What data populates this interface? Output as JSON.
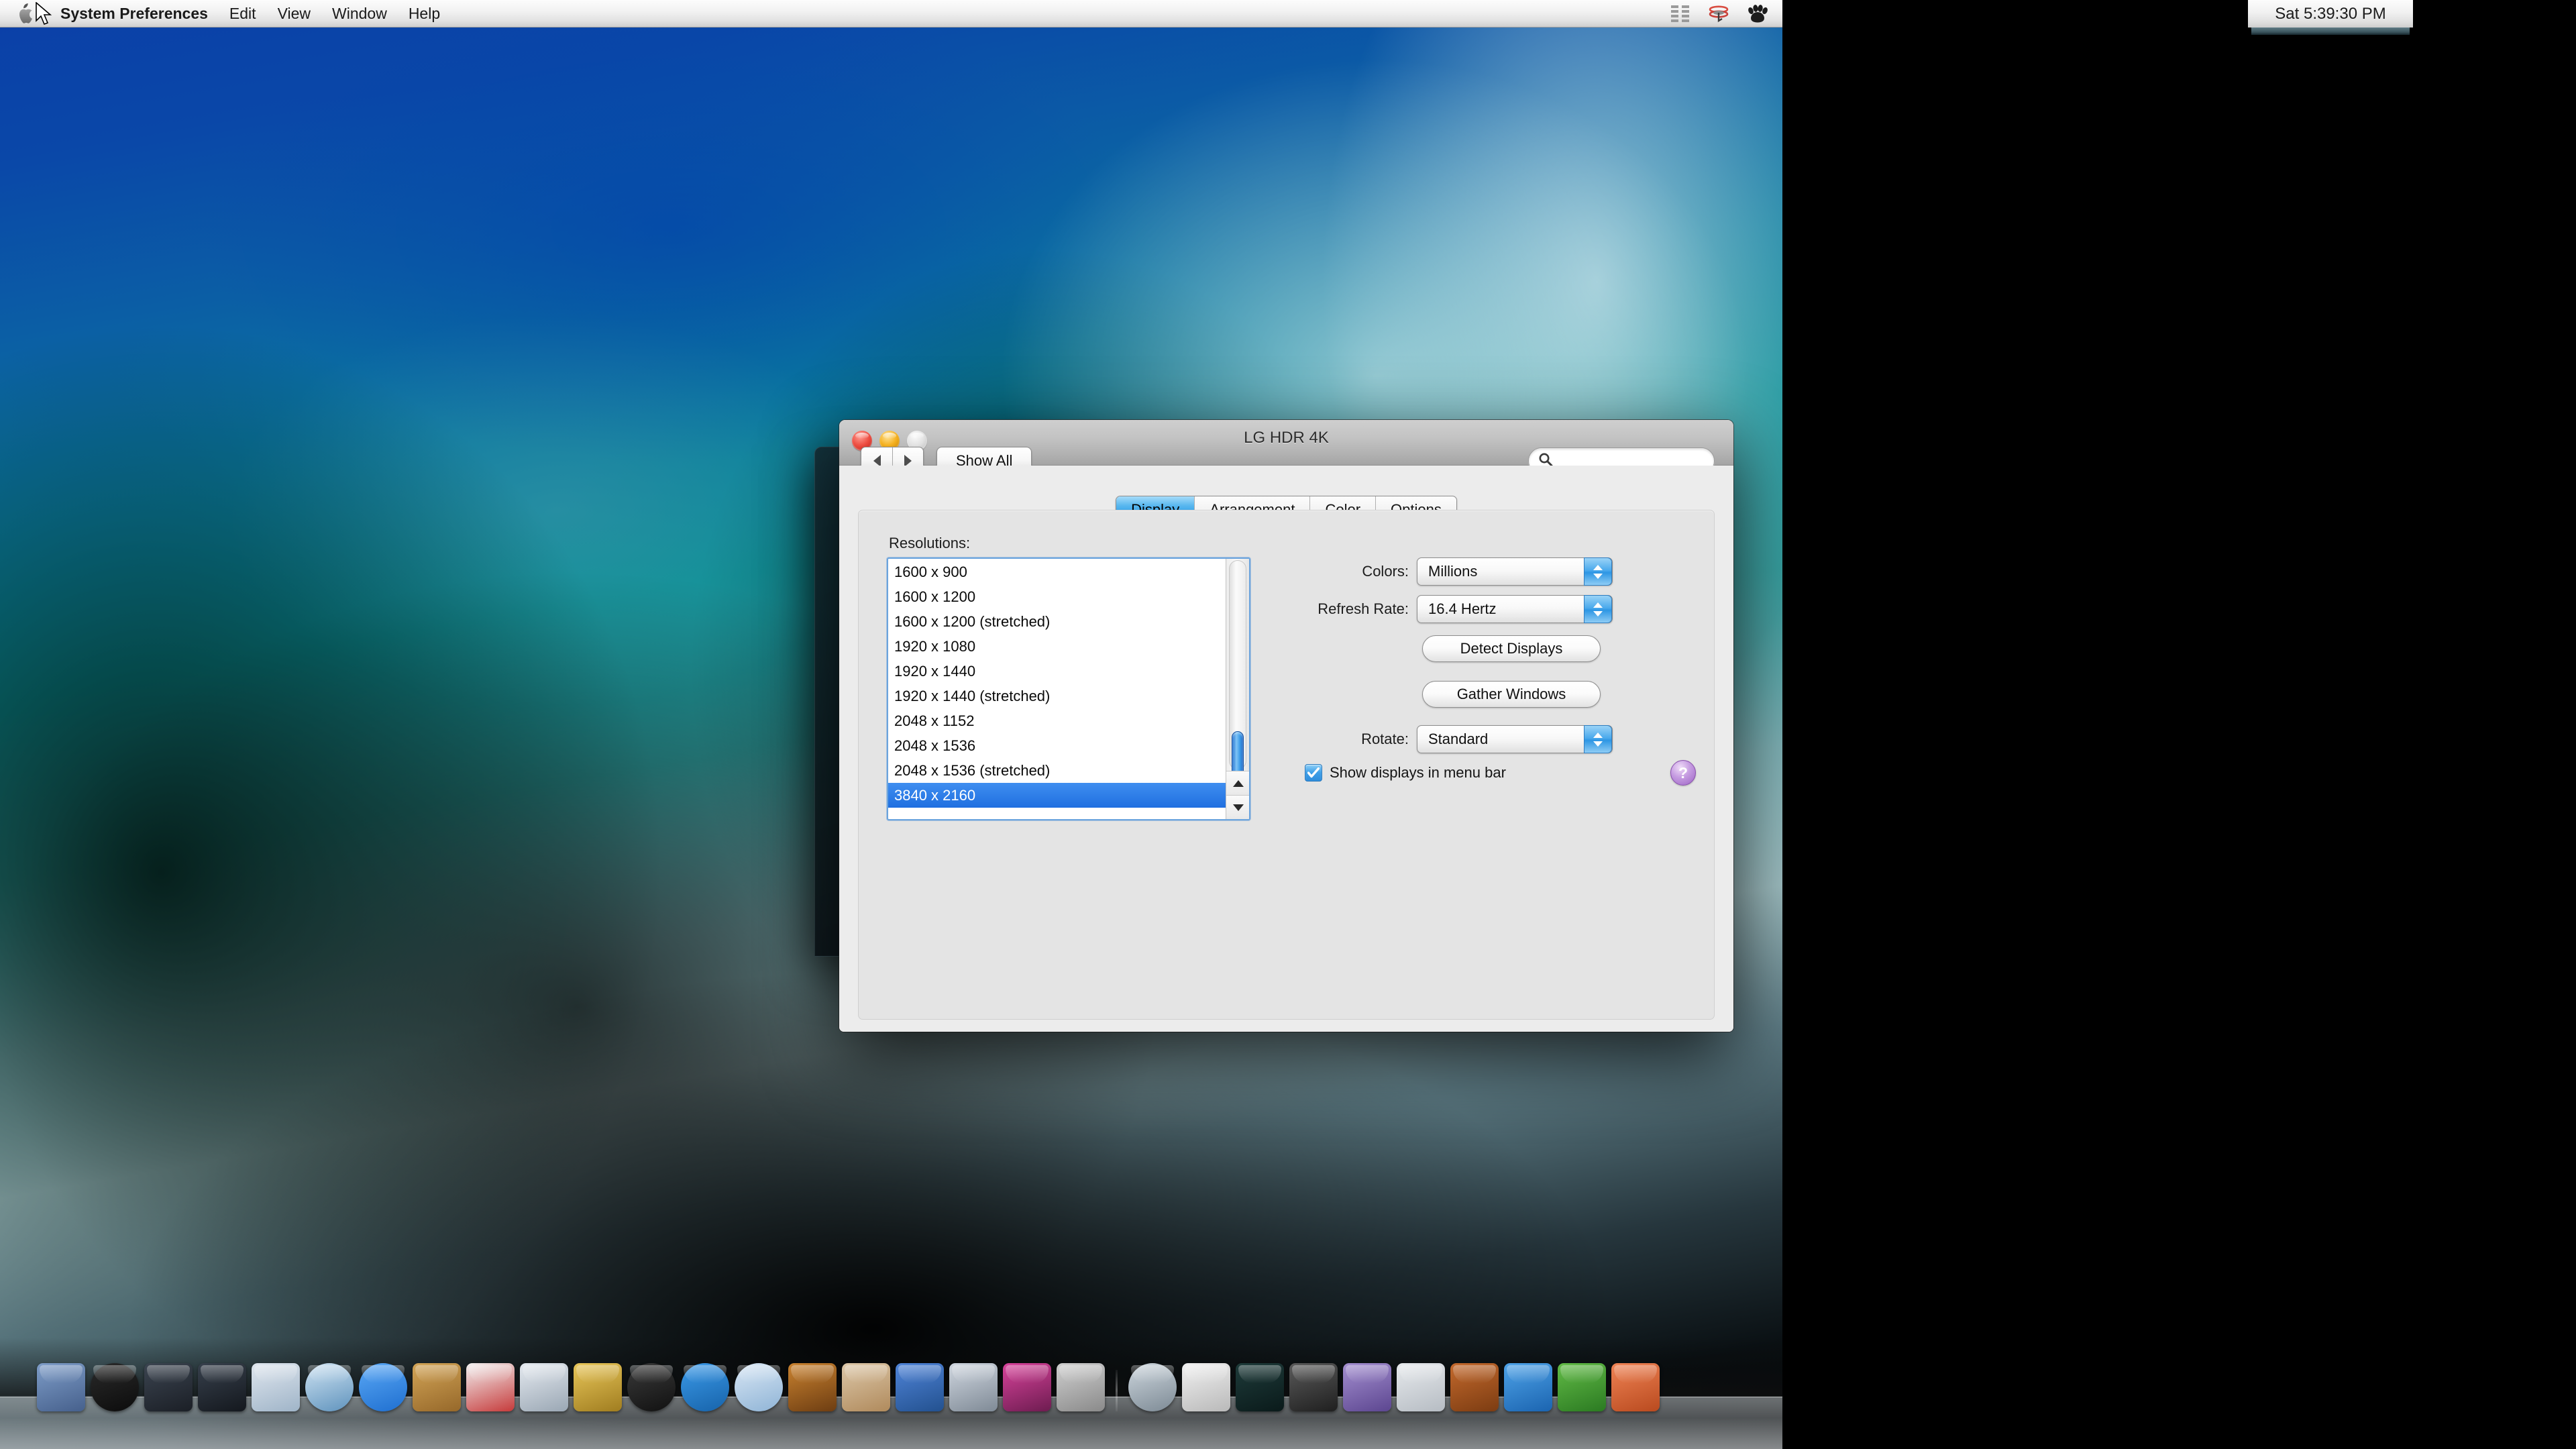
{
  "menubar": {
    "apple_icon": "apple-logo-icon",
    "items": [
      {
        "label": "System Preferences",
        "bold": true
      },
      {
        "label": "Edit",
        "bold": false
      },
      {
        "label": "View",
        "bold": false
      },
      {
        "label": "Window",
        "bold": false
      },
      {
        "label": "Help",
        "bold": false
      }
    ],
    "extras": [
      {
        "name": "text-input-menu-icon"
      },
      {
        "name": "displays-menu-icon"
      },
      {
        "name": "paw-print-menu-icon"
      }
    ]
  },
  "clock": {
    "text": "Sat 5:39:30 PM"
  },
  "window": {
    "title": "LG HDR 4K",
    "traffic_lights": [
      {
        "name": "close-button"
      },
      {
        "name": "minimize-button"
      },
      {
        "name": "zoom-button"
      }
    ],
    "nav": {
      "back_label": "◀",
      "forward_label": "▶"
    },
    "show_all_label": "Show All",
    "search": {
      "value": "",
      "placeholder": ""
    }
  },
  "tabs": [
    {
      "label": "Display",
      "active": true
    },
    {
      "label": "Arrangement",
      "active": false
    },
    {
      "label": "Color",
      "active": false
    },
    {
      "label": "Options",
      "active": false
    }
  ],
  "display_pane": {
    "resolutions_label": "Resolutions:",
    "resolutions": [
      {
        "label": "1600 x 900",
        "selected": false
      },
      {
        "label": "1600 x 1200",
        "selected": false
      },
      {
        "label": "1600 x 1200 (stretched)",
        "selected": false
      },
      {
        "label": "1920 x 1080",
        "selected": false
      },
      {
        "label": "1920 x 1440",
        "selected": false
      },
      {
        "label": "1920 x 1440 (stretched)",
        "selected": false
      },
      {
        "label": "2048 x 1152",
        "selected": false
      },
      {
        "label": "2048 x 1536",
        "selected": false
      },
      {
        "label": "2048 x 1536 (stretched)",
        "selected": false
      },
      {
        "label": "3840 x 2160",
        "selected": true
      }
    ],
    "selected_resolution": "3840 x 2160",
    "colors_label": "Colors:",
    "colors_value": "Millions",
    "refresh_label": "Refresh Rate:",
    "refresh_value": "16.4 Hertz",
    "detect_displays_label": "Detect Displays",
    "gather_windows_label": "Gather Windows",
    "rotate_label": "Rotate:",
    "rotate_value": "Standard",
    "show_in_menubar_label": "Show displays in menu bar",
    "show_in_menubar_checked": true,
    "help_label": "?"
  },
  "colors": {
    "accent_blue": "#2f9fe8",
    "selection_blue": "#1f6fe0",
    "help_purple": "#9d63c4",
    "window_chrome": "#c3c3c3",
    "panel_gray": "#e4e4e4"
  },
  "dock": {
    "items": [
      {
        "name": "dock-finder",
        "colors": "#7e9dc8,#46608c",
        "round": false
      },
      {
        "name": "dock-dashboard",
        "colors": "#2a2a2a,#0c0c0c",
        "round": true
      },
      {
        "name": "dock-mission-control",
        "colors": "#3b4450,#1b1f26",
        "round": false
      },
      {
        "name": "dock-launchpad",
        "colors": "#37404c,#14181e",
        "round": false
      },
      {
        "name": "dock-mail",
        "colors": "#dfe6ee,#9fb4c8",
        "round": false
      },
      {
        "name": "dock-safari",
        "colors": "#cfe3f2,#5f93bd",
        "round": true
      },
      {
        "name": "dock-facetime",
        "colors": "#5aa8f5,#1f6fd0",
        "round": true
      },
      {
        "name": "dock-address-book",
        "colors": "#d2a456,#96682a",
        "round": false
      },
      {
        "name": "dock-ical",
        "colors": "#f2f2f2,#c63a3a",
        "round": false
      },
      {
        "name": "dock-iphoto",
        "colors": "#e4e9ef,#9aa7b4",
        "round": false
      },
      {
        "name": "dock-imovie",
        "colors": "#e8c659,#a07d20",
        "round": false
      },
      {
        "name": "dock-photo-booth",
        "colors": "#3a3a3a,#111111",
        "round": true
      },
      {
        "name": "dock-idvd",
        "colors": "#3b9ae8,#1763aa",
        "round": true
      },
      {
        "name": "dock-itunes",
        "colors": "#d8e6f4,#8fb4d6",
        "round": true
      },
      {
        "name": "dock-garageband",
        "colors": "#c9822f,#6d3d12",
        "round": false
      },
      {
        "name": "dock-iweb",
        "colors": "#dcc7a8,#b08a5c",
        "round": false
      },
      {
        "name": "dock-xcode",
        "colors": "#4f84d8,#23518f",
        "round": false
      },
      {
        "name": "dock-quicktime",
        "colors": "#cfd6df,#7f8a96",
        "round": false
      },
      {
        "name": "dock-imac-display",
        "colors": "#d8439b,#6d1c50",
        "round": false
      },
      {
        "name": "dock-system-preferences",
        "colors": "#cfcfcf,#8a8a8a",
        "round": false
      },
      {
        "name": "dock-time-machine",
        "colors": "#cdd6dd,#7d8a95",
        "round": true
      },
      {
        "name": "dock-final-cut-pro",
        "colors": "#f0f0f0,#b9b9b9",
        "round": false
      },
      {
        "name": "dock-soundtrack-pro",
        "colors": "#1e3b3a,#0a1a1a",
        "round": false
      },
      {
        "name": "dock-dvd-studio-pro",
        "colors": "#5a5a5a,#1f1f1f",
        "round": false
      },
      {
        "name": "dock-aperture",
        "colors": "#a48fd0,#5c4690",
        "round": false
      },
      {
        "name": "dock-numbers",
        "colors": "#e6e9ec,#b6bcc3",
        "round": false
      },
      {
        "name": "dock-keynote",
        "colors": "#c3692c,#7c3c12",
        "round": false
      },
      {
        "name": "dock-word",
        "colors": "#4ea3e8,#1b64b0",
        "round": false
      },
      {
        "name": "dock-excel",
        "colors": "#62bb46,#2b7a22",
        "round": false
      },
      {
        "name": "dock-powerpoint",
        "colors": "#ef8354,#b94a1f",
        "round": false
      }
    ]
  }
}
